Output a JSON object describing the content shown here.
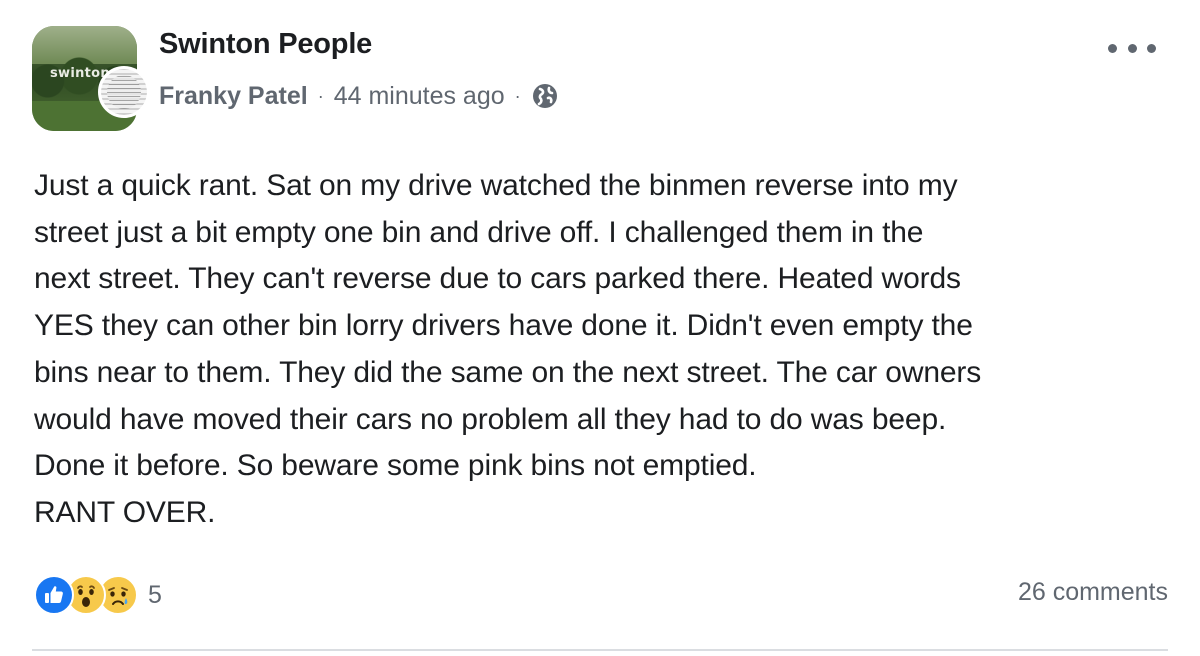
{
  "post": {
    "group": {
      "name": "Swinton People",
      "avatar_text": "swinton"
    },
    "author": {
      "name": "Franky Patel"
    },
    "timestamp": "44 minutes ago",
    "meta_separator": "·",
    "privacy_icon": "globe-icon",
    "more_icon": "more-options-icon",
    "body_lines": [
      "Just a quick rant. Sat on my drive watched the binmen reverse into my",
      "street just a bit empty one bin and drive off. I challenged them in the",
      "next street. They can't reverse due to cars parked there. Heated words",
      "YES they can other bin lorry drivers have done it. Didn't even empty the",
      "bins near to them. They did the same on the next street. The car owners",
      "would have moved their cars no problem all they had to do was beep.",
      "Done it before. So beware some pink bins not emptied.",
      "RANT OVER."
    ],
    "reactions": {
      "icons": [
        "like-icon",
        "wow-icon",
        "sad-icon"
      ],
      "count": "5"
    },
    "comments_label": "26 comments"
  },
  "colors": {
    "text_primary": "#1c1e21",
    "text_secondary": "#606770",
    "like_blue": "#1877f2",
    "emoji_yellow": "#f7c94b",
    "divider": "#dadde1"
  }
}
